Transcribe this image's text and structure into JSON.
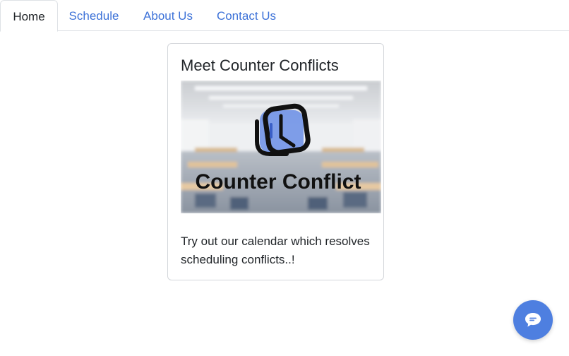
{
  "nav": {
    "tabs": [
      {
        "label": "Home",
        "active": true
      },
      {
        "label": "Schedule",
        "active": false
      },
      {
        "label": "About Us",
        "active": false
      },
      {
        "label": "Contact Us",
        "active": false
      }
    ]
  },
  "card": {
    "title": "Meet Counter Conflicts",
    "image_caption": "Counter Conflict",
    "text": "Try out our calendar which resolves scheduling conflicts..!"
  },
  "chat": {
    "icon": "chat-bubble-icon",
    "color": "#4e7fe0"
  },
  "colors": {
    "link": "#3d72d8",
    "text": "#212529",
    "border": "#dee2e6"
  }
}
